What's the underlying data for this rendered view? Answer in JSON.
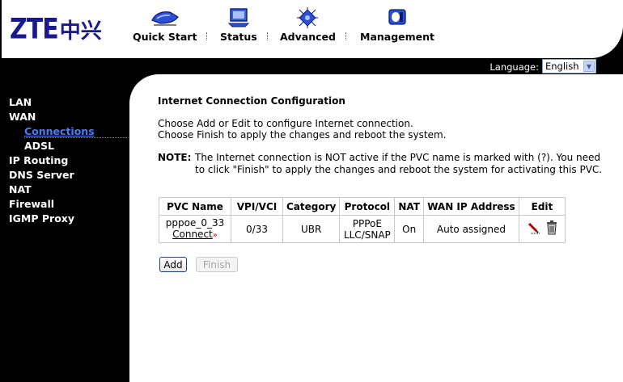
{
  "logo": {
    "brand": "ZTE",
    "brand_cn": "中兴"
  },
  "topnav": [
    {
      "label": "Quick Start",
      "icon": "quick-start-icon"
    },
    {
      "label": "Status",
      "icon": "monitor-icon"
    },
    {
      "label": "Advanced",
      "icon": "chip-icon"
    },
    {
      "label": "Management",
      "icon": "management-icon"
    }
  ],
  "language": {
    "label": "Language:",
    "selected": "English"
  },
  "sidebar": {
    "items": [
      {
        "label": "LAN"
      },
      {
        "label": "WAN"
      },
      {
        "label": "Connections"
      },
      {
        "label": "ADSL"
      },
      {
        "label": "IP Routing"
      },
      {
        "label": "DNS Server"
      },
      {
        "label": "NAT"
      },
      {
        "label": "Firewall"
      },
      {
        "label": "IGMP Proxy"
      }
    ]
  },
  "main": {
    "title": "Internet Connection Configuration",
    "desc1": "Choose Add or Edit to configure Internet connection.",
    "desc2": "Choose Finish to apply the changes and reboot the system.",
    "note_label": "NOTE:",
    "note1": "The Internet connection is NOT active if the PVC name is marked with (?). You need",
    "note2": "to click \"Finish\" to apply the changes and reboot the system for activating this PVC.",
    "table": {
      "headers": [
        "PVC Name",
        "VPI/VCI",
        "Category",
        "Protocol",
        "NAT",
        "WAN IP Address",
        "Edit"
      ],
      "rows": [
        {
          "pvc_name": "pppoe_0_33",
          "connect": "Connect",
          "vpi_vci": "0/33",
          "category": "UBR",
          "protocol1": "PPPoE",
          "protocol2": "LLC/SNAP",
          "nat": "On",
          "wan_ip": "Auto assigned"
        }
      ]
    },
    "add_label": "Add",
    "finish_label": "Finish"
  },
  "colors": {
    "brand": "#1a1a8c",
    "active_link": "#4a7df5",
    "background": "#000000"
  }
}
